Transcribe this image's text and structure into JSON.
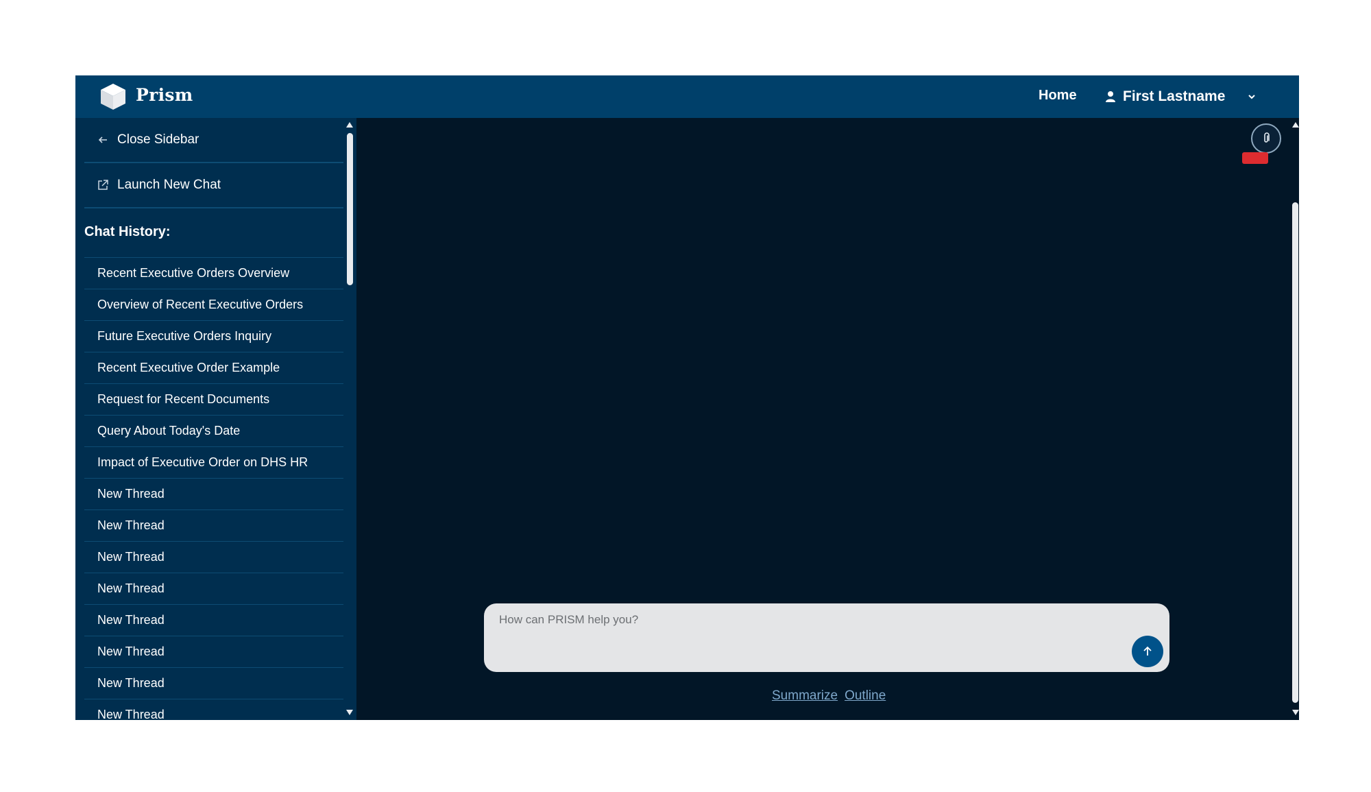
{
  "header": {
    "brand": "Prism",
    "logo_icon": "cube-icon",
    "nav_home": "Home",
    "user_name": "First Lastname"
  },
  "sidebar": {
    "close_label": "Close Sidebar",
    "launch_label": "Launch New Chat",
    "history_title": "Chat History:",
    "history": [
      "Recent Executive Orders Overview",
      "Overview of Recent Executive Orders",
      "Future Executive Orders Inquiry",
      "Recent Executive Order Example",
      "Request for Recent Documents",
      "Query About Today's Date",
      "Impact of Executive Order on DHS HR",
      "New Thread",
      "New Thread",
      "New Thread",
      "New Thread",
      "New Thread",
      "New Thread",
      "New Thread",
      "New Thread"
    ]
  },
  "main": {
    "input_placeholder": "How can PRISM help you?",
    "links": [
      "Summarize",
      "Outline"
    ]
  },
  "colors": {
    "header_bg": "#00406a",
    "sidebar_bg": "#002e4f",
    "main_bg": "#021627",
    "accent": "#00528a",
    "alert": "#dd2c30"
  }
}
